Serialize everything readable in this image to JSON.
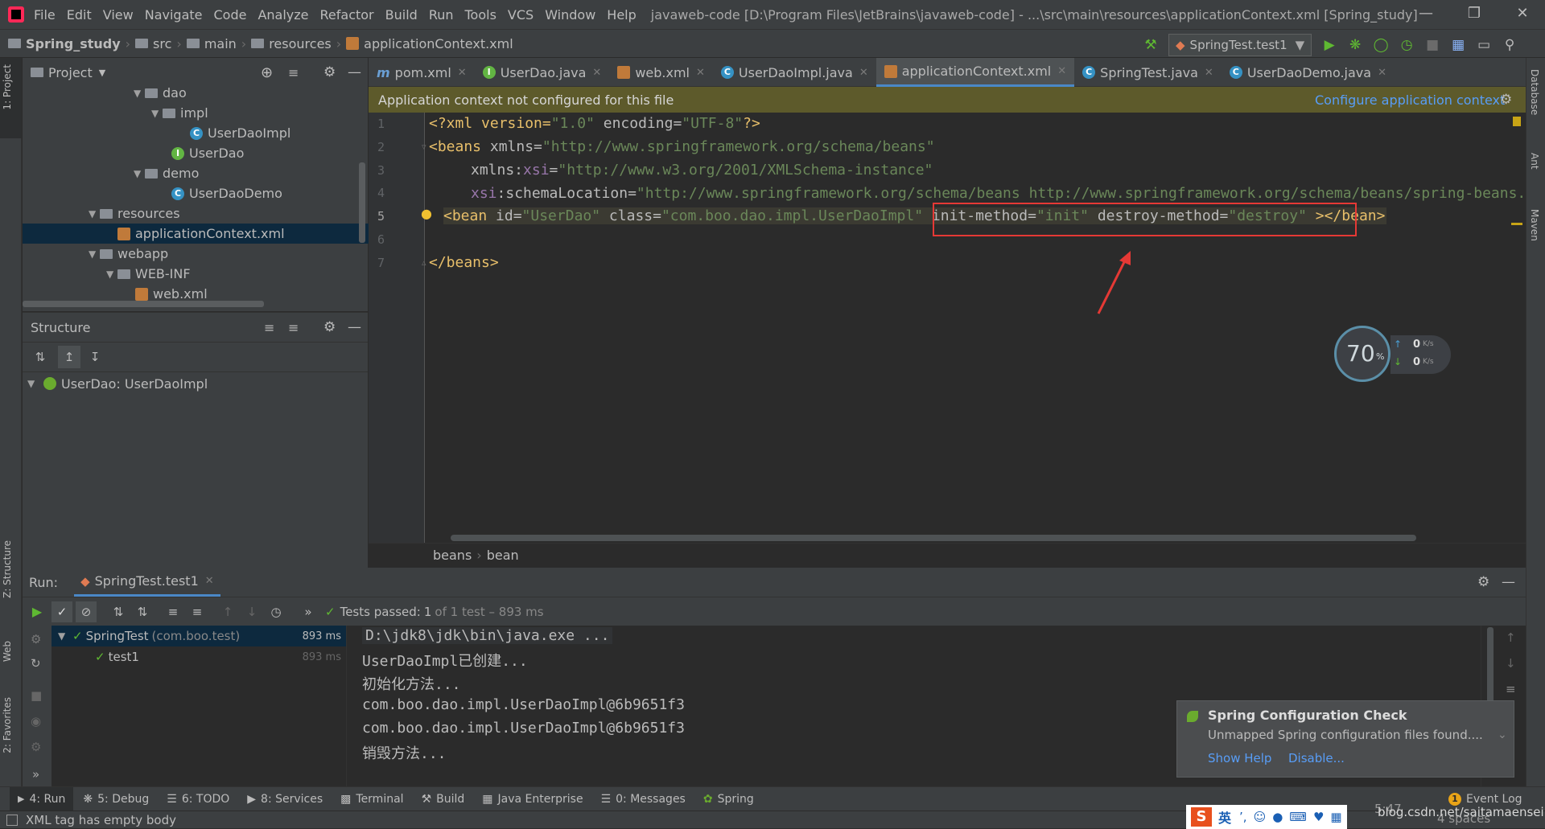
{
  "menubar": {
    "items": [
      "File",
      "Edit",
      "View",
      "Navigate",
      "Code",
      "Analyze",
      "Refactor",
      "Build",
      "Run",
      "Tools",
      "VCS",
      "Window",
      "Help"
    ],
    "window_title": "javaweb-code [D:\\Program Files\\JetBrains\\javaweb-code] - ...\\src\\main\\resources\\applicationContext.xml [Spring_study]"
  },
  "breadcrumbs": [
    "Spring_study",
    "src",
    "main",
    "resources",
    "applicationContext.xml"
  ],
  "run_config": "SpringTest.test1",
  "left_stripe": {
    "project": "1: Project",
    "structure": "Z: Structure",
    "web": "Web",
    "favorites": "2: Favorites"
  },
  "right_stripe": {
    "database": "Database",
    "ant": "Ant",
    "maven": "Maven"
  },
  "project_panel": {
    "title": "Project",
    "tree": [
      {
        "label": "dao"
      },
      {
        "label": "impl"
      },
      {
        "label": "UserDaoImpl"
      },
      {
        "label": "UserDao"
      },
      {
        "label": "demo"
      },
      {
        "label": "UserDaoDemo"
      },
      {
        "label": "resources"
      },
      {
        "label": "applicationContext.xml"
      },
      {
        "label": "webapp"
      },
      {
        "label": "WEB-INF"
      },
      {
        "label": "web.xml"
      }
    ]
  },
  "structure_panel": {
    "title": "Structure",
    "root": "UserDao: UserDaoImpl"
  },
  "tabs": [
    "pom.xml",
    "UserDao.java",
    "web.xml",
    "UserDaoImpl.java",
    "applicationContext.xml",
    "SpringTest.java",
    "UserDaoDemo.java"
  ],
  "banner": {
    "message": "Application context not configured for this file",
    "action": "Configure application context"
  },
  "editor": {
    "line_numbers": [
      "1",
      "2",
      "3",
      "4",
      "5",
      "6",
      "7"
    ],
    "line1": {
      "a": "<?xml version=",
      "b": "\"1.0\"",
      "c": " encoding=",
      "d": "\"UTF-8\"",
      "e": "?>"
    },
    "line2": {
      "a": "<beans ",
      "b": "xmlns=",
      "c": "\"http://www.springframework.org/schema/beans\""
    },
    "line3": {
      "a": "xmlns:",
      "b": "xsi",
      "c": "=",
      "d": "\"http://www.w3.org/2001/XMLSchema-instance\""
    },
    "line4": {
      "a": "xsi",
      "b": ":schemaLocation=",
      "c": "\"http://www.springframework.org/schema/beans http://www.springframework.org/schema/beans/spring-beans.xsd\">"
    },
    "line5": {
      "a": "<bean ",
      "b": "id=",
      "c": "\"UserDao\"",
      "d": " class=",
      "e": "\"com.boo.dao.impl.UserDaoImpl\"",
      "f": " init-method=",
      "g": "\"init\"",
      "h": " destroy-method=",
      "i": "\"destroy\"",
      "j": " ></bean>"
    },
    "line7": "</beans>",
    "breadcrumb": [
      "beans",
      "bean"
    ]
  },
  "monitor": {
    "percent": "70",
    "unit": "%",
    "up": "0",
    "down": "0",
    "rate_unit": "K/s"
  },
  "run_panel": {
    "label": "Run:",
    "config_tab": "SpringTest.test1",
    "status_prefix": "Tests passed:",
    "status_count": "1",
    "status_rest": "of 1 test – 893 ms",
    "tests": [
      {
        "name": "SpringTest",
        "pkg": "(com.boo.test)",
        "time": "893 ms"
      },
      {
        "name": "test1",
        "pkg": "",
        "time": "893 ms"
      }
    ],
    "console": [
      "D:\\jdk8\\jdk\\bin\\java.exe ...",
      "UserDaoImpl已创建...",
      "初始化方法...",
      "com.boo.dao.impl.UserDaoImpl@6b9651f3",
      "com.boo.dao.impl.UserDaoImpl@6b9651f3",
      "销毁方法..."
    ]
  },
  "notification": {
    "title": "Spring Configuration Check",
    "body": "Unmapped Spring configuration files found....",
    "link1": "Show Help",
    "link2": "Disable..."
  },
  "tool_windows": [
    {
      "label": "4: Run"
    },
    {
      "label": "5: Debug"
    },
    {
      "label": "6: TODO"
    },
    {
      "label": "8: Services"
    },
    {
      "label": "Terminal"
    },
    {
      "label": "Build"
    },
    {
      "label": "Java Enterprise"
    },
    {
      "label": "0: Messages"
    },
    {
      "label": "Spring"
    }
  ],
  "event_log": {
    "count": "1",
    "label": "Event Log"
  },
  "status": {
    "message": "XML tag has empty body",
    "position": "5:47",
    "indent": "4 spaces",
    "watermark": "blog.csdn.net/saitamaensei",
    "ime": "英"
  },
  "colors": {
    "accent": "#4a88c7",
    "link": "#589df6",
    "pass": "#5fb832",
    "annotation": "#e53935"
  }
}
